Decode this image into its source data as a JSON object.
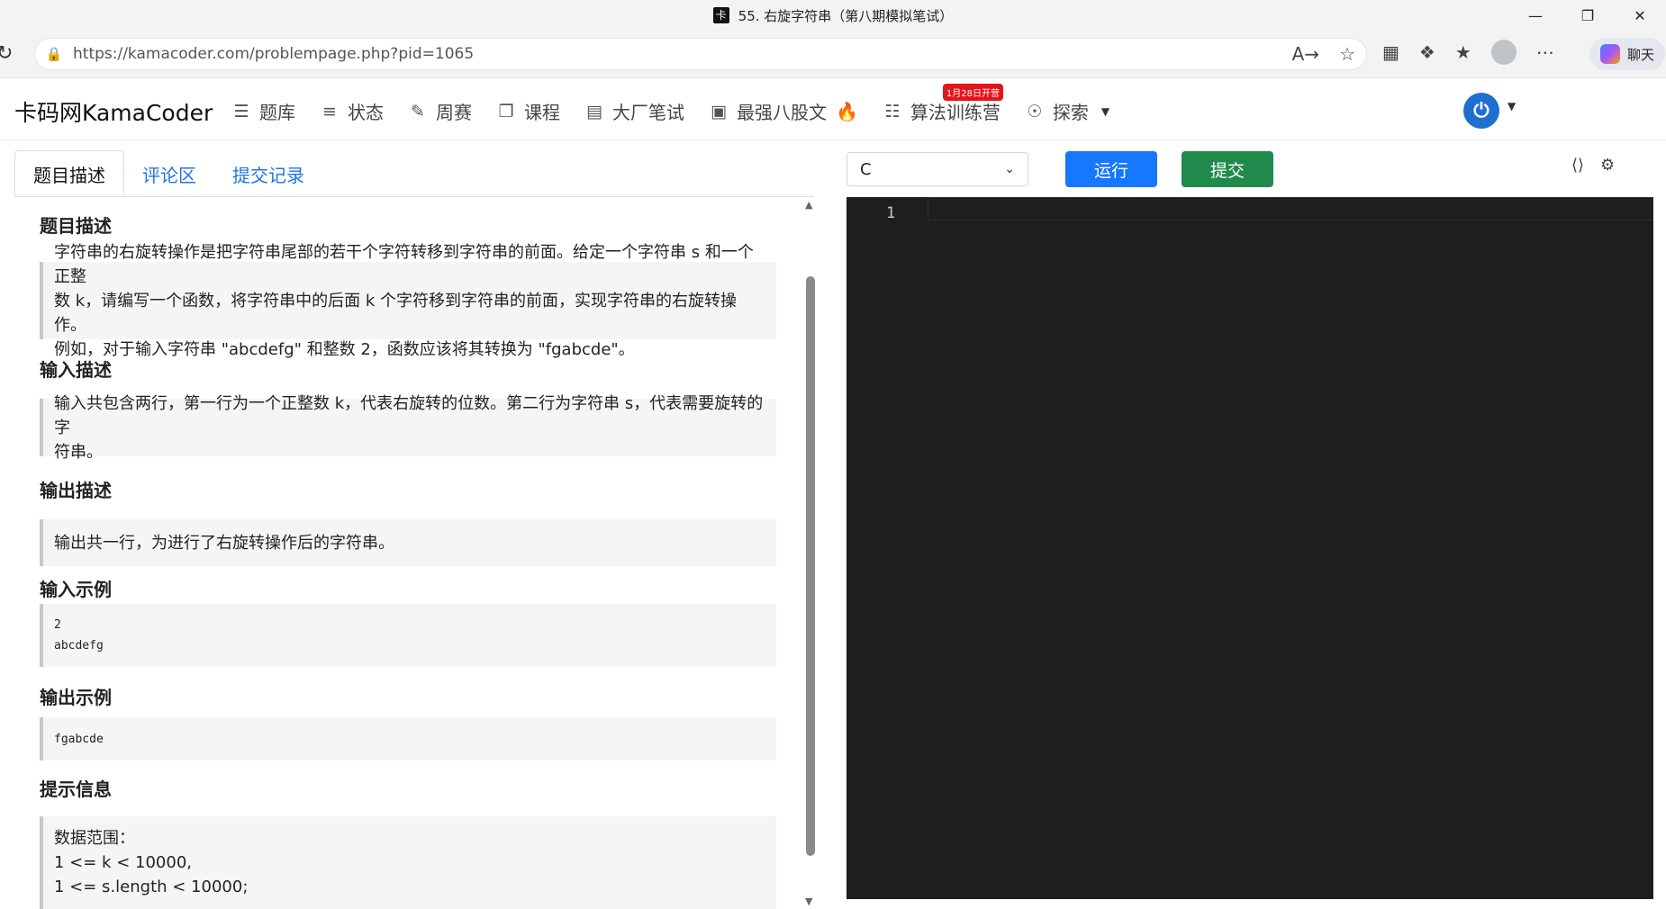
{
  "browser": {
    "tab_title": "55. 右旋字符串（第八期模拟笔试）",
    "url": "https://kamacoder.com/problempage.php?pid=1065",
    "chat_label": "聊天"
  },
  "site": {
    "brand": "卡码网KamaCoder",
    "nav": [
      {
        "label": "题库",
        "icon": "list-icon"
      },
      {
        "label": "状态",
        "icon": "status-list-icon"
      },
      {
        "label": "周赛",
        "icon": "pencil-icon"
      },
      {
        "label": "课程",
        "icon": "book-icon"
      },
      {
        "label": "大厂笔试",
        "icon": "document-icon"
      },
      {
        "label": "最强八股文",
        "icon": "code-file-icon"
      },
      {
        "label": "算法训练营",
        "icon": "calendar-icon",
        "badge": "1月28日开营"
      },
      {
        "label": "探索",
        "icon": "compass-icon"
      }
    ]
  },
  "tabs": [
    "题目描述",
    "评论区",
    "提交记录"
  ],
  "problem": {
    "sections": [
      {
        "title": "题目描述",
        "lines": [
          "字符串的右旋转操作是把字符串尾部的若干个字符转移到字符串的前面。给定一个字符串 s 和一个正整",
          "数 k，请编写一个函数，将字符串中的后面 k 个字符移到字符串的前面，实现字符串的右旋转操作。",
          "例如，对于输入字符串 \"abcdefg\" 和整数 2，函数应该将其转换为 \"fgabcde\"。"
        ]
      },
      {
        "title": "输入描述",
        "lines": [
          "输入共包含两行，第一行为一个正整数 k，代表右旋转的位数。第二行为字符串 s，代表需要旋转的字",
          "符串。"
        ]
      },
      {
        "title": "输出描述",
        "lines": [
          "输出共一行，为进行了右旋转操作后的字符串。"
        ]
      },
      {
        "title": "输入示例",
        "lines": [
          "2",
          "abcdefg"
        ]
      },
      {
        "title": "输出示例",
        "lines": [
          "fgabcde"
        ]
      },
      {
        "title": "提示信息",
        "lines": [
          "数据范围：",
          "1 <= k < 10000,",
          "1 <= s.length < 10000;"
        ]
      }
    ]
  },
  "editor": {
    "language": "C",
    "run_label": "运行",
    "submit_label": "提交",
    "line_number": "1"
  }
}
